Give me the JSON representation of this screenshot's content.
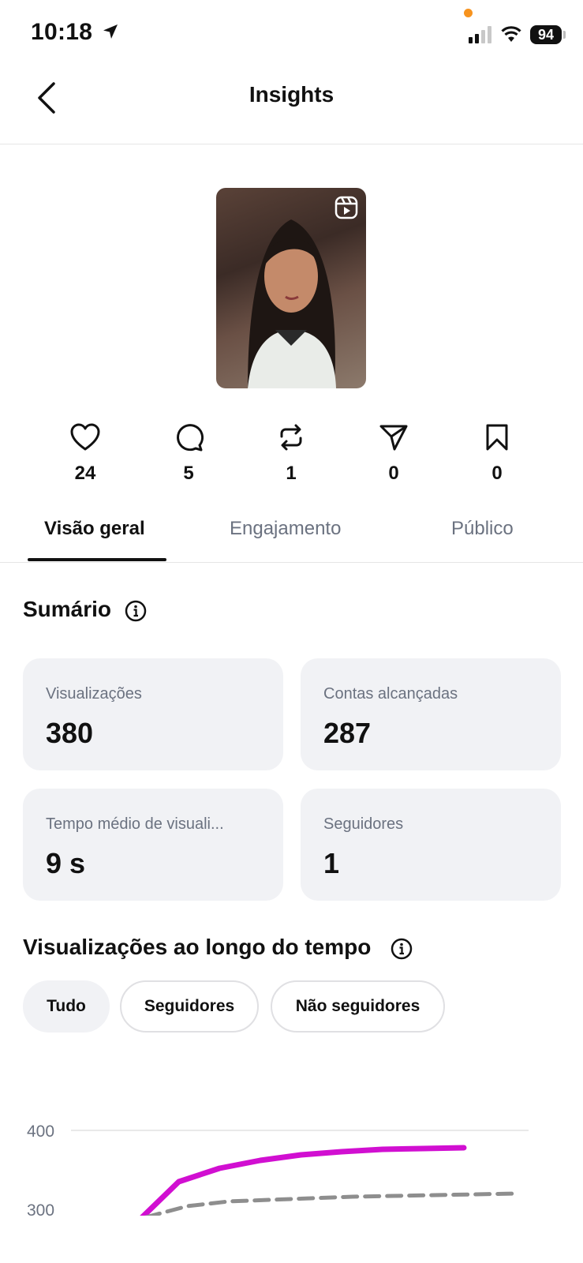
{
  "status_bar": {
    "time": "10:18",
    "battery": "94"
  },
  "header": {
    "title": "Insights"
  },
  "metrics": [
    {
      "icon": "heart-icon",
      "value": "24"
    },
    {
      "icon": "comment-icon",
      "value": "5"
    },
    {
      "icon": "repost-icon",
      "value": "1"
    },
    {
      "icon": "send-icon",
      "value": "0"
    },
    {
      "icon": "bookmark-icon",
      "value": "0"
    }
  ],
  "tabs": [
    {
      "label": "Visão geral",
      "active": true
    },
    {
      "label": "Engajamento",
      "active": false
    },
    {
      "label": "Público",
      "active": false
    }
  ],
  "summary": {
    "title": "Sumário",
    "cards": [
      {
        "label": "Visualizações",
        "value": "380"
      },
      {
        "label": "Contas alcançadas",
        "value": "287"
      },
      {
        "label": "Tempo médio de visuali...",
        "value": "9 s"
      },
      {
        "label": "Seguidores",
        "value": "1"
      }
    ]
  },
  "views_over_time": {
    "title": "Visualizações ao longo do tempo",
    "filters": [
      {
        "label": "Tudo",
        "active": true
      },
      {
        "label": "Seguidores",
        "active": false
      },
      {
        "label": "Não seguidores",
        "active": false
      }
    ]
  },
  "colors": {
    "accent_line": "#d10fd1",
    "dashed_line": "#8e8e8e"
  },
  "chart_data": {
    "type": "line",
    "y_tick_labels": [
      "400",
      "300"
    ],
    "ylim": [
      300,
      400
    ],
    "grid": true,
    "series": [
      {
        "style": "solid",
        "color": "#d10fd1",
        "values": [
          285,
          335,
          352,
          362,
          369,
          373,
          376,
          377,
          378
        ]
      },
      {
        "style": "dashed",
        "color": "#8e8e8e",
        "values": [
          290,
          304,
          310,
          312,
          314,
          316,
          317,
          318,
          319,
          320
        ]
      }
    ]
  }
}
